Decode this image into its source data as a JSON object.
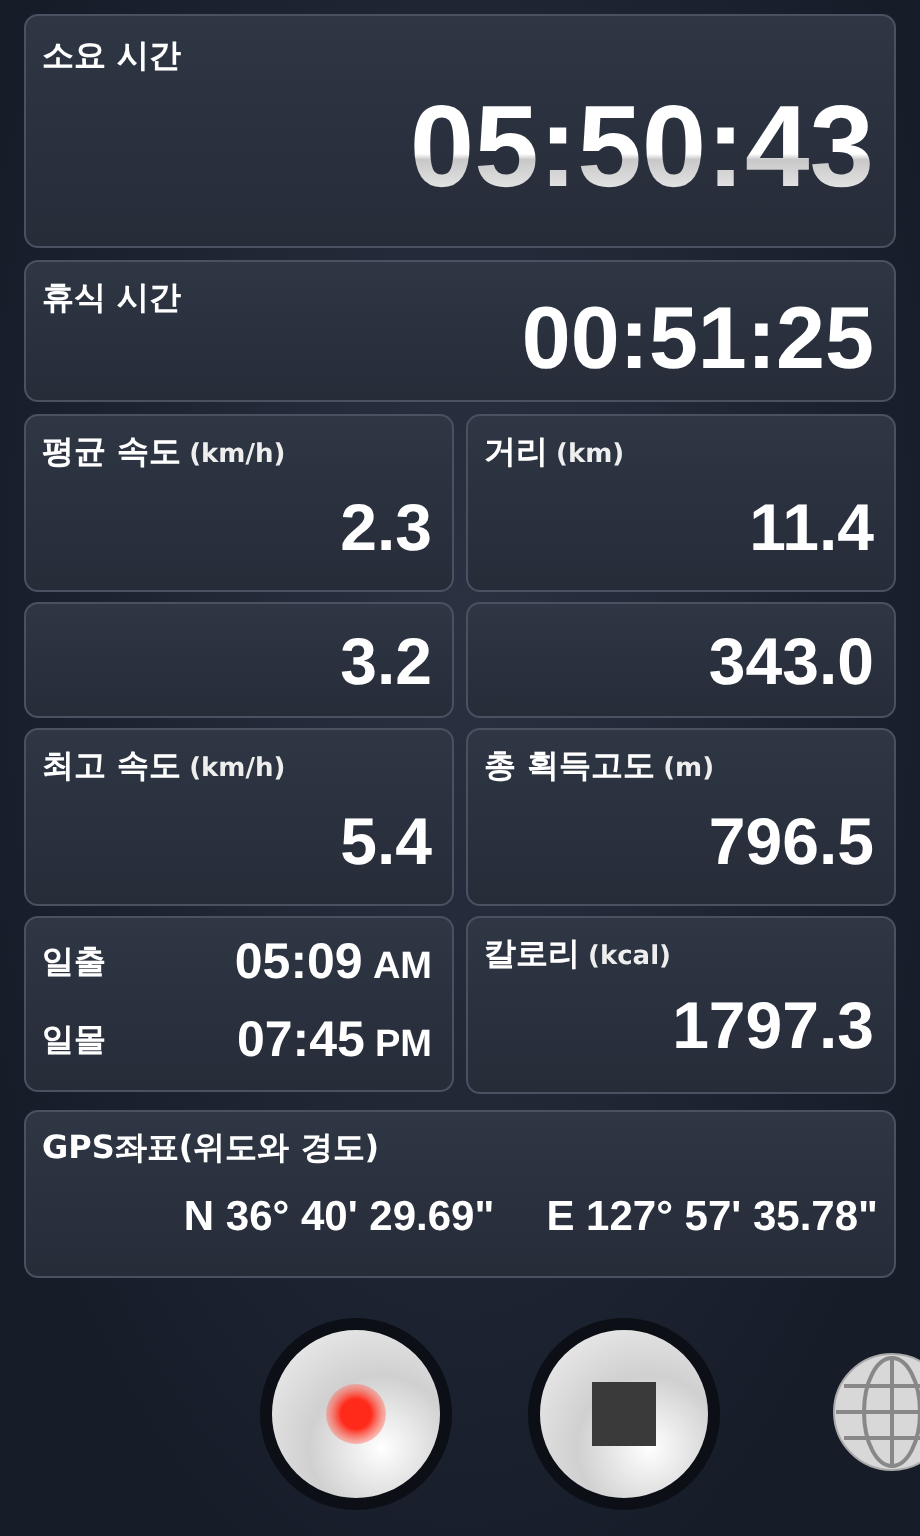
{
  "elapsed": {
    "label": "소요 시간",
    "value": "05:50:43"
  },
  "rest": {
    "label": "휴식 시간",
    "value": "00:51:25"
  },
  "stats": [
    {
      "label": "평균 속도",
      "unit": "(km/h)",
      "value": "2.3"
    },
    {
      "label": "거리",
      "unit": "(km)",
      "value": "11.4"
    },
    {
      "value": "3.2"
    },
    {
      "value": "343.0"
    },
    {
      "label": "최고 속도",
      "unit": "(km/h)",
      "value": "5.4"
    },
    {
      "label": "총 획득고도",
      "unit": "(m)",
      "value": "796.5"
    }
  ],
  "sun": [
    {
      "label": "일출",
      "time": "05:09",
      "ampm": "AM"
    },
    {
      "label": "일몰",
      "time": "07:45",
      "ampm": "PM"
    }
  ],
  "calories": {
    "label": "칼로리",
    "unit": "(kcal)",
    "value": "1797.3"
  },
  "gps": {
    "label": "GPS좌표(위도와 경도)",
    "lat": "N 36° 40' 29.69\"",
    "lon": "E 127° 57' 35.78\""
  }
}
